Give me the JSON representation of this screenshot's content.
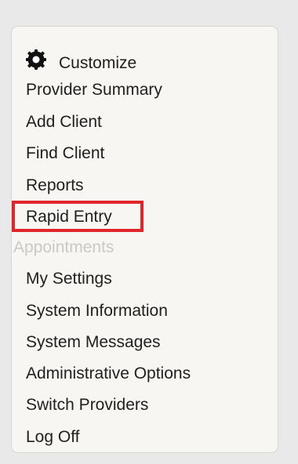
{
  "menu": {
    "customize": {
      "label": "Customize",
      "icon": "gear-icon"
    },
    "items": [
      {
        "label": "Provider Summary",
        "enabled": true
      },
      {
        "label": "Add Client",
        "enabled": true
      },
      {
        "label": "Find Client",
        "enabled": true
      },
      {
        "label": "Reports",
        "enabled": true
      },
      {
        "label": "Rapid Entry",
        "enabled": true,
        "highlighted": true
      },
      {
        "label": "Appointments",
        "enabled": false
      },
      {
        "label": "My Settings",
        "enabled": true
      },
      {
        "label": "System Information",
        "enabled": true
      },
      {
        "label": "System Messages",
        "enabled": true
      },
      {
        "label": "Administrative Options",
        "enabled": true
      },
      {
        "label": "Switch Providers",
        "enabled": true
      },
      {
        "label": "Log Off",
        "enabled": true
      }
    ]
  },
  "colors": {
    "highlight_border": "#e0252d",
    "disabled_text": "#c9c9c9",
    "panel_background": "#f7f6f2"
  }
}
